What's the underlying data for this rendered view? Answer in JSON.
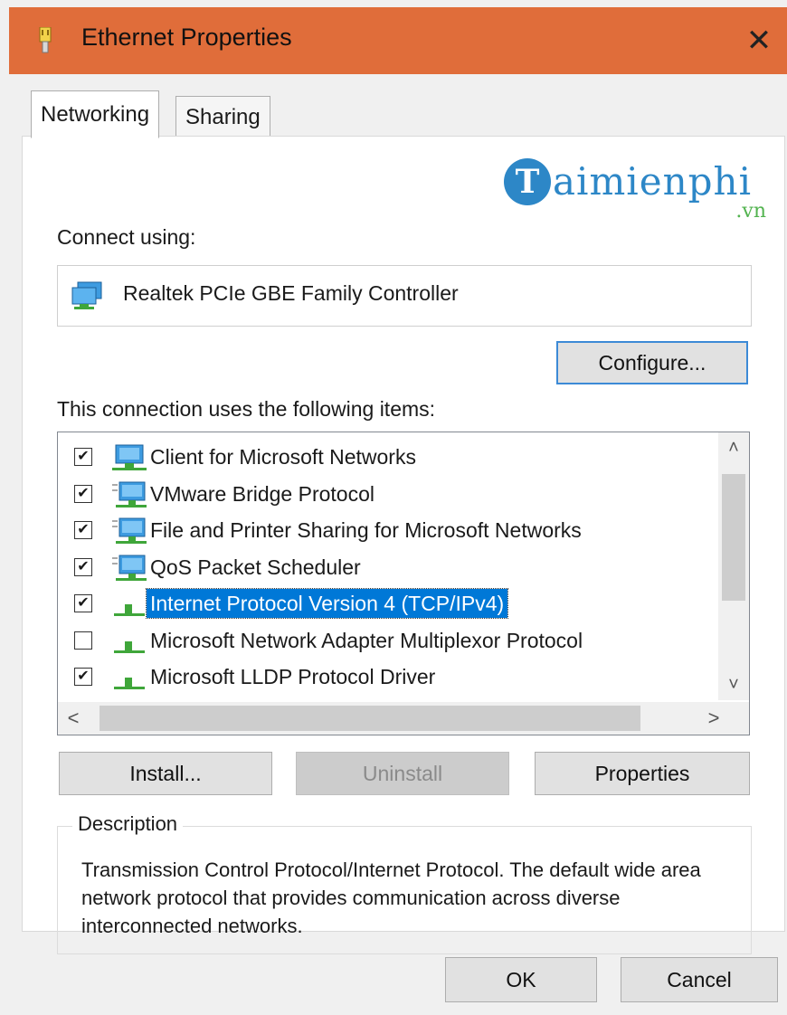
{
  "window": {
    "title": "Ethernet Properties",
    "close_glyph": "✕",
    "accent": "#e06d3a"
  },
  "tabs": [
    {
      "label": "Networking",
      "active": true
    },
    {
      "label": "Sharing",
      "active": false
    }
  ],
  "watermark": {
    "initial": "T",
    "name": "aimienphi",
    "suffix": ".vn"
  },
  "connect_using": {
    "label": "Connect using:",
    "adapter": "Realtek PCIe GBE Family Controller",
    "icon": "network-adapter-icon"
  },
  "configure_button": "Configure...",
  "items_label": "This connection uses the following items:",
  "items": [
    {
      "label": "Client for Microsoft Networks",
      "checked": true,
      "icon": "network-client-icon",
      "selected": false
    },
    {
      "label": "VMware Bridge Protocol",
      "checked": true,
      "icon": "network-service-icon",
      "selected": false
    },
    {
      "label": "File and Printer Sharing for Microsoft Networks",
      "checked": true,
      "icon": "network-service-icon",
      "selected": false
    },
    {
      "label": "QoS Packet Scheduler",
      "checked": true,
      "icon": "network-service-icon",
      "selected": false
    },
    {
      "label": "Internet Protocol Version 4 (TCP/IPv4)",
      "checked": true,
      "icon": "protocol-icon",
      "selected": true
    },
    {
      "label": "Microsoft Network Adapter Multiplexor Protocol",
      "checked": false,
      "icon": "protocol-icon",
      "selected": false
    },
    {
      "label": "Microsoft LLDP Protocol Driver",
      "checked": true,
      "icon": "protocol-icon",
      "selected": false
    }
  ],
  "scroll": {
    "up": "˄",
    "down": "˅",
    "left": "<",
    "right": ">"
  },
  "buttons": {
    "install": "Install...",
    "uninstall": "Uninstall",
    "properties": "Properties",
    "ok": "OK",
    "cancel": "Cancel"
  },
  "description": {
    "legend": "Description",
    "text": "Transmission Control Protocol/Internet Protocol. The default wide area network protocol that provides communication across diverse interconnected networks."
  },
  "check_glyph": "✔"
}
